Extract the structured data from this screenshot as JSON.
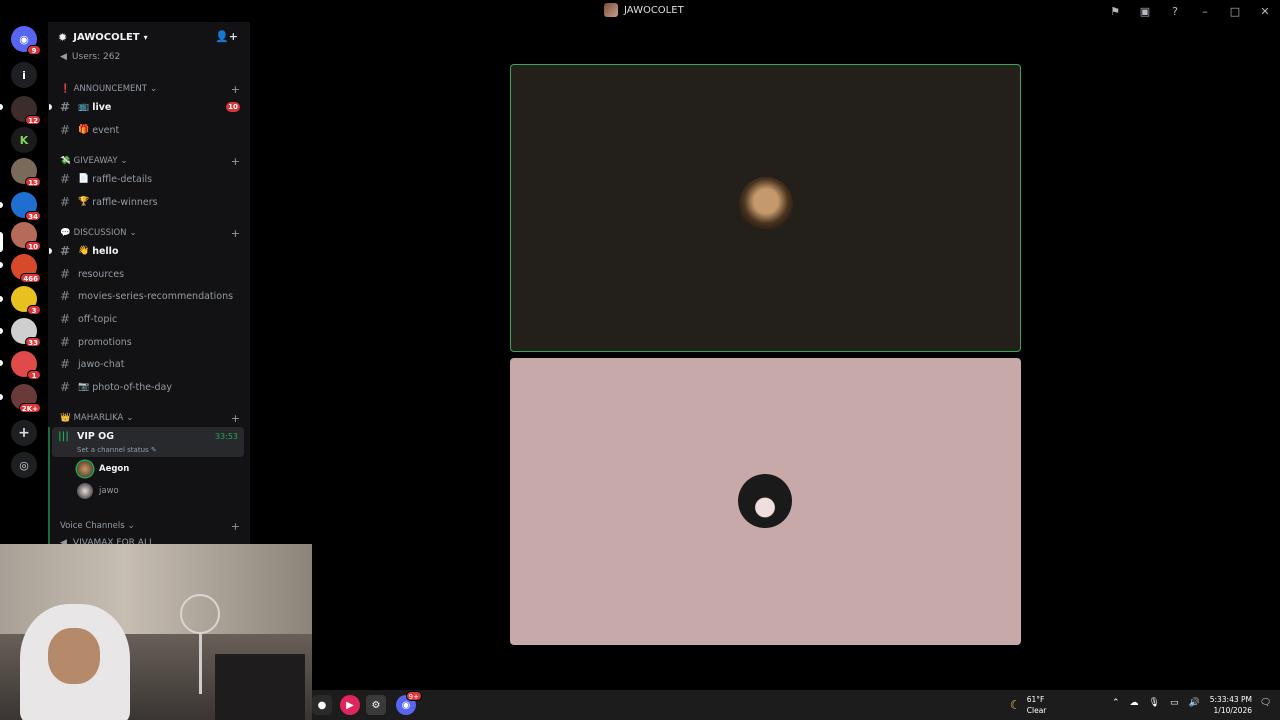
{
  "window": {
    "title": "JAWOCOLET",
    "controls": [
      "minimize",
      "maximize",
      "close"
    ]
  },
  "rail": {
    "dm_badge": "9",
    "servers": [
      {
        "name": "server-1",
        "badge": "",
        "color": "#5865f2",
        "glyph": "i"
      },
      {
        "name": "server-2",
        "badge": "12",
        "color": "#3a2d2a",
        "glyph": ""
      },
      {
        "name": "server-3",
        "badge": "",
        "color": "#1b1b1b",
        "glyph": "K"
      },
      {
        "name": "server-4",
        "badge": "13",
        "color": "#7a6a5a",
        "glyph": ""
      },
      {
        "name": "server-5",
        "badge": "34",
        "color": "#1f6fd1",
        "glyph": ""
      },
      {
        "name": "server-6",
        "badge": "10",
        "color": "#b86a5a",
        "glyph": ""
      },
      {
        "name": "server-7",
        "badge": "466",
        "color": "#d64a2a",
        "glyph": ""
      },
      {
        "name": "server-8",
        "badge": "3",
        "color": "#e8c020",
        "glyph": ""
      },
      {
        "name": "server-9",
        "badge": "33",
        "color": "#cfcfcf",
        "glyph": ""
      },
      {
        "name": "server-10",
        "badge": "1",
        "color": "#e04a4a",
        "glyph": ""
      },
      {
        "name": "server-11",
        "badge": "2K+",
        "color": "#6a3a3a",
        "glyph": ""
      }
    ]
  },
  "server": {
    "name": "JAWOCOLET",
    "users_line": "Users: 262"
  },
  "categories": {
    "announcement": "ANNOUNCEMENT",
    "giveaway": "GIVEAWAY",
    "discussion": "DISCUSSION",
    "maharlika": "MAHARLIKA",
    "voice": "Voice Channels"
  },
  "channels": {
    "live": "live",
    "live_mention": "10",
    "event": "event",
    "raffle_details": "raffle-details",
    "raffle_winners": "raffle-winners",
    "hello": "hello",
    "resources": "resources",
    "movies": "movies-series-recommendations",
    "off_topic": "off-topic",
    "promotions": "promotions",
    "jawo_chat": "jawo-chat",
    "photo": "photo-of-the-day"
  },
  "voice": {
    "channel_name": "VIP OG",
    "elapsed": "33:53",
    "status_placeholder": "Set a channel status",
    "users": [
      "Aegon",
      "jawo"
    ],
    "cut_channel": "VIVAMAX FOR ALL"
  },
  "taskbar": {
    "weather_temp": "61°F",
    "weather_cond": "Clear",
    "time": "5:33:43 PM",
    "date": "1/10/2026",
    "discord_badge": "9+"
  },
  "colors": {
    "speaking": "#3ba55c",
    "mention": "#da373c",
    "tile_dark": "#231f1b",
    "tile_pink": "#c8a9a9"
  }
}
